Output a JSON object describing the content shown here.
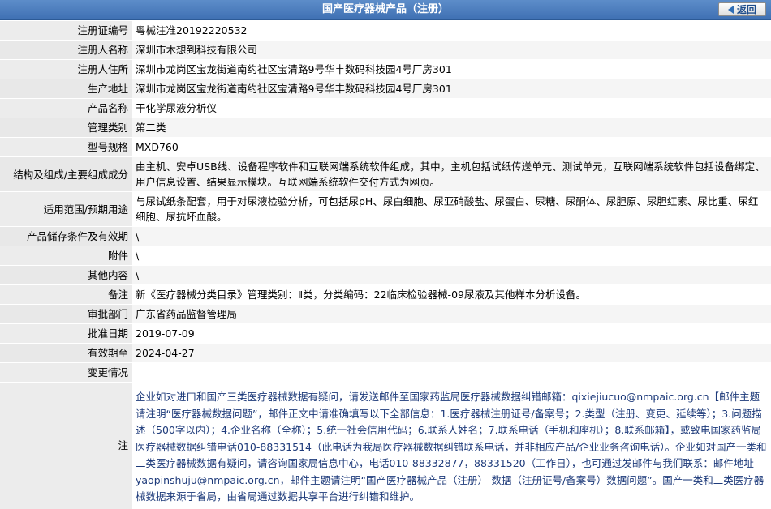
{
  "header": {
    "title": "国产医疗器械产品（注册）",
    "back_label": "返回"
  },
  "rows": [
    {
      "label": "注册证编号",
      "value": "粤械注准20192220532"
    },
    {
      "label": "注册人名称",
      "value": "深圳市木想到科技有限公司"
    },
    {
      "label": "注册人住所",
      "value": "深圳市龙岗区宝龙街道南约社区宝清路9号华丰数码科技园4号厂房301"
    },
    {
      "label": "生产地址",
      "value": "深圳市龙岗区宝龙街道南约社区宝清路9号华丰数码科技园4号厂房301"
    },
    {
      "label": "产品名称",
      "value": "干化学尿液分析仪"
    },
    {
      "label": "管理类别",
      "value": "第二类"
    },
    {
      "label": "型号规格",
      "value": "MXD760"
    },
    {
      "label": "结构及组成/主要组成成分",
      "value": "由主机、安卓USB线、设备程序软件和互联网端系统软件组成，其中，主机包括试纸传送单元、测试单元，互联网端系统软件包括设备绑定、用户信息设置、结果显示模块。互联网端系统软件交付方式为网页。"
    },
    {
      "label": "适用范围/预期用途",
      "value": "与尿试纸条配套，用于对尿液检验分析，可包括尿pH、尿白细胞、尿亚硝酸盐、尿蛋白、尿糖、尿酮体、尿胆原、尿胆红素、尿比重、尿红细胞、尿抗坏血酸。"
    },
    {
      "label": "产品储存条件及有效期",
      "value": "\\"
    },
    {
      "label": "附件",
      "value": "\\"
    },
    {
      "label": "其他内容",
      "value": "\\"
    },
    {
      "label": "备注",
      "value": "新《医疗器械分类目录》管理类别：Ⅱ类，分类编码：22临床检验器械-09尿液及其他样本分析设备。"
    },
    {
      "label": "审批部门",
      "value": "广东省药品监督管理局"
    },
    {
      "label": "批准日期",
      "value": "2019-07-09"
    },
    {
      "label": "有效期至",
      "value": "2024-04-27"
    },
    {
      "label": "变更情况",
      "value": ""
    }
  ],
  "note": {
    "label": "注",
    "text": "企业如对进口和国产三类医疗器械数据有疑问，请发送邮件至国家药监局医疗器械数据纠错邮箱：qixiejiucuo@nmpaic.org.cn【邮件主题请注明“医疗器械数据问题”，邮件正文中请准确填写以下全部信息：1.医疗器械注册证号/备案号；2.类型（注册、变更、延续等）；3.问题描述（500字以内）；4.企业名称（全称）；5.统一社会信用代码；6.联系人姓名；7.联系电话（手机和座机）；8.联系邮箱】，或致电国家药监局医疗器械数据纠错电话010-88331514（此电话为我局医疗器械数据纠错联系电话，并非相应产品/企业业务咨询电话）。企业如对国产一类和二类医疗器械数据有疑问，请咨询国家局信息中心，电话010-88332877，88331520（工作日），也可通过发邮件与我们联系：邮件地址yaopinshuju@nmpaic.org.cn，邮件主题请注明“国产医疗器械产品（注册）-数据（注册证号/备案号）数据问题”。国产一类和二类医疗器械数据来源于省局，由省局通过数据共享平台进行纠错和维护。"
  },
  "colors": {
    "header_bg": "#4a7cbf",
    "label_bg": "#ececec",
    "note_text": "#1d3a7a"
  }
}
